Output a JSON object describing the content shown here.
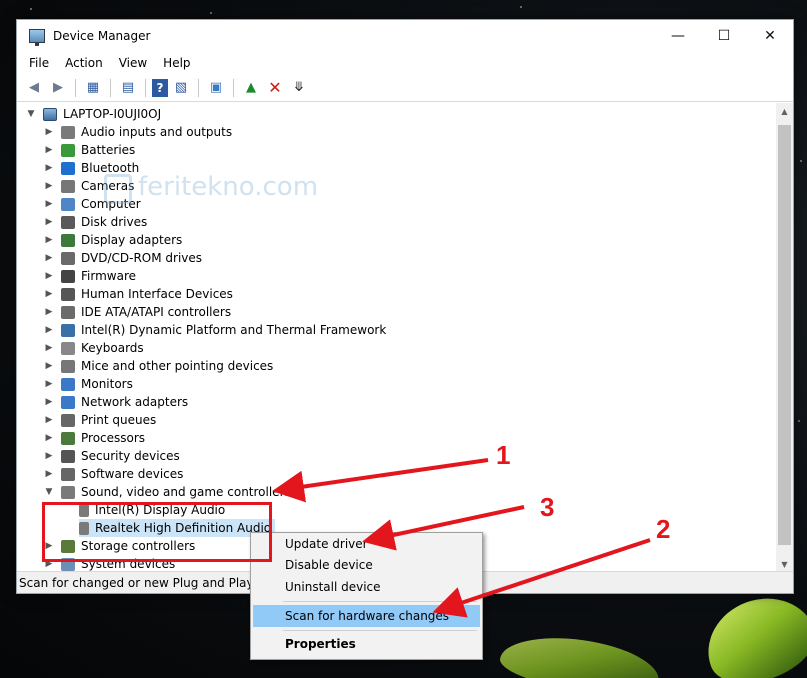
{
  "window": {
    "title": "Device Manager",
    "controls": [
      "—",
      "☐",
      "✕"
    ]
  },
  "menu": [
    "File",
    "Action",
    "View",
    "Help"
  ],
  "toolbar_icons": [
    "back-icon",
    "forward-icon",
    "show-hide-icon",
    "properties-icon",
    "help-icon",
    "details-icon",
    "scan-icon",
    "update-driver-icon",
    "uninstall-icon",
    "download-icon"
  ],
  "tree": {
    "root": "LAPTOP-I0UJI0OJ",
    "categories": [
      "Audio inputs and outputs",
      "Batteries",
      "Bluetooth",
      "Cameras",
      "Computer",
      "Disk drives",
      "Display adapters",
      "DVD/CD-ROM drives",
      "Firmware",
      "Human Interface Devices",
      "IDE ATA/ATAPI controllers",
      "Intel(R) Dynamic Platform and Thermal Framework",
      "Keyboards",
      "Mice and other pointing devices",
      "Monitors",
      "Network adapters",
      "Print queues",
      "Processors",
      "Security devices",
      "Software devices",
      "Sound, video and game controllers"
    ],
    "sound_children": [
      "Intel(R) Display Audio",
      "Realtek High Definition Audio"
    ],
    "after": [
      "Storage controllers",
      "System devices"
    ]
  },
  "status_text": "Scan for changed or new Plug and Play devi",
  "context_menu": {
    "items": [
      "Update driver",
      "Disable device",
      "Uninstall device",
      "Scan for hardware changes",
      "Properties"
    ]
  },
  "watermark": "feritekno.com",
  "annotations": [
    "1",
    "2",
    "3"
  ],
  "colors": {
    "accent_red": "#e4161d",
    "selection": "#cce4f7",
    "menu_highlight": "#91c9f7"
  }
}
